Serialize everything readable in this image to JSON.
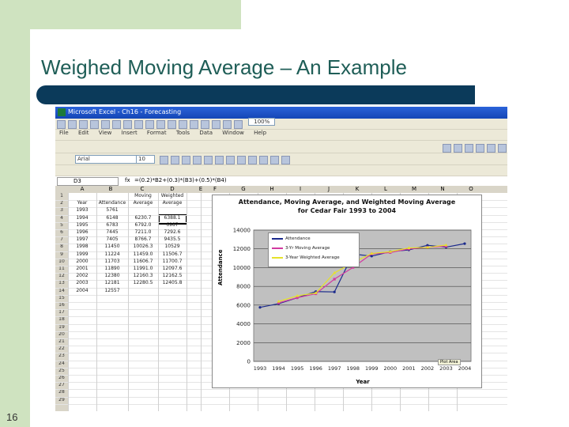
{
  "slide": {
    "title": "Weighed Moving Average – An Example",
    "number": "16"
  },
  "excel": {
    "window_title": "Microsoft Excel - Ch16 - Forecasting",
    "menu": [
      "File",
      "Edit",
      "View",
      "Insert",
      "Format",
      "Tools",
      "Data",
      "Window",
      "Help"
    ],
    "font_name": "Arial",
    "font_size": "10",
    "zoom": "100%",
    "name_box": "D3",
    "fx": "fx",
    "formula": "=(0.2)*B2+(0.3)*(B3)+(0.5)*(B4)",
    "columns": [
      "A",
      "B",
      "C",
      "D",
      "E",
      "F",
      "G",
      "H",
      "I",
      "J",
      "K",
      "L",
      "M",
      "N",
      "O"
    ],
    "headers": {
      "a": "Year",
      "b": "Attendance",
      "c1": "Moving",
      "c2": "Average",
      "d1": "Weighted",
      "d2": "Average"
    },
    "rows": [
      [
        "1993",
        "5761",
        "",
        ""
      ],
      [
        "1994",
        "6148",
        "6230.7",
        "6388.1"
      ],
      [
        "1995",
        "6783",
        "6792.0",
        "6987"
      ],
      [
        "1996",
        "7445",
        "7211.0",
        "7292.6"
      ],
      [
        "1997",
        "7405",
        "8766.7",
        "9435.5"
      ],
      [
        "1998",
        "11450",
        "10026.3",
        "10529"
      ],
      [
        "1999",
        "11224",
        "11459.0",
        "11506.7"
      ],
      [
        "2000",
        "11703",
        "11606.7",
        "11700.7"
      ],
      [
        "2001",
        "11890",
        "11991.0",
        "12097.6"
      ],
      [
        "2002",
        "12380",
        "12160.3",
        "12162.5"
      ],
      [
        "2003",
        "12181",
        "12280.5",
        "12405.8"
      ],
      [
        "2004",
        "12557",
        "",
        ""
      ]
    ],
    "row_count": 29,
    "selected_value": "6388.1"
  },
  "chart_badge": "Plot Area",
  "chart_data": {
    "type": "line",
    "title": "Attendance, Moving Average, and Weighted Moving Average",
    "subtitle": "for Cedar Fair 1993 to 2004",
    "xlabel": "Year",
    "ylabel": "Attendance",
    "categories": [
      "1993",
      "1994",
      "1995",
      "1996",
      "1997",
      "1998",
      "1999",
      "2000",
      "2001",
      "2002",
      "2003",
      "2004"
    ],
    "ylim": [
      0,
      14000
    ],
    "yticks": [
      "0",
      "2000",
      "4000",
      "6000",
      "8000",
      "10000",
      "12000",
      "14000"
    ],
    "grid": true,
    "legend_position": "top-left",
    "series": [
      {
        "name": "Attendance",
        "color": "#1b2a8c",
        "values": [
          5761,
          6148,
          6783,
          7445,
          7405,
          11450,
          11224,
          11703,
          11890,
          12380,
          12181,
          12557
        ]
      },
      {
        "name": "3-Yr Moving Average",
        "color": "#d23aa0",
        "values": [
          null,
          6230.7,
          6792.0,
          7211.0,
          8766.7,
          10026.3,
          11459.0,
          11606.7,
          11991.0,
          12160.3,
          12280.5,
          null
        ]
      },
      {
        "name": "3-Year Weighted Average",
        "color": "#e6e22a",
        "values": [
          null,
          6388.1,
          6987,
          7292.6,
          9435.5,
          10529,
          11506.7,
          11700.7,
          12097.6,
          12162.5,
          12405.8,
          null
        ]
      }
    ]
  }
}
